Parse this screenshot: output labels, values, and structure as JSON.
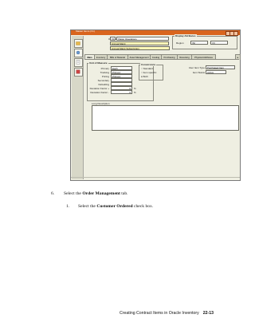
{
  "window": {
    "title": "Master Items (V1)"
  },
  "header": {
    "organization_label": "Organization",
    "organization_code": "V1",
    "organization_name": "Vision Operations",
    "item_label": "Item",
    "item_value": "Annual Maint",
    "description_label": "Description",
    "description_value": "Annual Maint Subscription"
  },
  "display_attributes": {
    "title": "Display Attributes",
    "region_label": "Region",
    "region_value": "(N)",
    "column_value": "(V)"
  },
  "tabs": [
    {
      "label": "Main",
      "active": true
    },
    {
      "label": "Inventory"
    },
    {
      "label": "Bills of Material"
    },
    {
      "label": "Asset Management"
    },
    {
      "label": "Costing"
    },
    {
      "label": "Purchasing"
    },
    {
      "label": "Receiving"
    },
    {
      "label": "Physical Attributes"
    }
  ],
  "unit_of_measure": {
    "title": "Unit of Measure",
    "primary_label": "Primary",
    "primary_value": "Each",
    "tracking_label": "Tracking",
    "tracking_value": "Primary",
    "pricing_label": "Pricing",
    "pricing_value": "Primary",
    "secondary_label": "Secondary",
    "defaulting_label": "Defaulting",
    "deviation_factor_plus_label": "Deviation Factor +",
    "deviation_factor_plus_value": "0",
    "deviation_factor_minus_label": "Deviation Factor -",
    "deviation_factor_minus_value": "0",
    "percent": "%"
  },
  "conversions": {
    "title": "Conversions",
    "options": [
      "Standard",
      "Item specific",
      "Both"
    ],
    "selected": "Both"
  },
  "item_type": {
    "user_item_type_label": "User Item Type",
    "user_item_type_value": "Purchased Item",
    "item_status_label": "Item Status",
    "item_status_value": "Active"
  },
  "long_description_label": "Long Description",
  "instructions": [
    {
      "num": "6.",
      "prefix": "Select the ",
      "bold": "Order Management",
      "suffix": " tab."
    },
    {
      "num": "1.",
      "prefix": "Select the ",
      "bold": "Customer Ordered",
      "suffix": " check box."
    }
  ],
  "footer": {
    "text": "Creating Contract Items in Oracle Inventory",
    "page": "22-13"
  }
}
